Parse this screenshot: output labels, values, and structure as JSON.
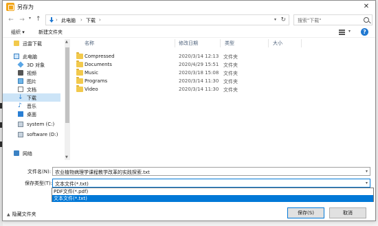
{
  "window": {
    "title": "另存为"
  },
  "address": {
    "crumbs": [
      "此电脑",
      "下载"
    ],
    "search_placeholder": "搜索\"下载\""
  },
  "toolbar": {
    "organize": "组织 ▾",
    "new_folder": "新建文件夹"
  },
  "sidebar": {
    "items": [
      {
        "label": "迅雷下载",
        "icon": "folder-icon"
      },
      {
        "label": "此电脑",
        "icon": "computer-icon"
      },
      {
        "label": "3D 对象",
        "icon": "cube-icon"
      },
      {
        "label": "视频",
        "icon": "video-icon"
      },
      {
        "label": "图片",
        "icon": "picture-icon"
      },
      {
        "label": "文档",
        "icon": "document-icon"
      },
      {
        "label": "下载",
        "icon": "download-icon"
      },
      {
        "label": "音乐",
        "icon": "music-icon"
      },
      {
        "label": "桌面",
        "icon": "desktop-icon"
      },
      {
        "label": "system (C:)",
        "icon": "drive-icon"
      },
      {
        "label": "software (D:)",
        "icon": "drive-icon"
      },
      {
        "label": "网络",
        "icon": "network-icon"
      }
    ]
  },
  "filelist": {
    "columns": [
      "名称",
      "修改日期",
      "类型",
      "大小"
    ],
    "rows": [
      {
        "name": "Compressed",
        "date": "2020/3/14 12:13",
        "type": "文件夹"
      },
      {
        "name": "Documents",
        "date": "2020/4/29 15:51",
        "type": "文件夹"
      },
      {
        "name": "Music",
        "date": "2020/3/18 15:08",
        "type": "文件夹"
      },
      {
        "name": "Programs",
        "date": "2020/3/14 11:30",
        "type": "文件夹"
      },
      {
        "name": "Video",
        "date": "2020/3/14 11:30",
        "type": "文件夹"
      }
    ]
  },
  "fields": {
    "filename_label": "文件名(N):",
    "filename_value": "农业植物病理学课程教学改革的实践探索.txt",
    "type_label": "保存类型(T):",
    "type_value": "文本文件(*.txt)",
    "type_options": [
      "PDF文件(*.pdf)",
      "文本文件(*.txt)"
    ]
  },
  "footer": {
    "hide_folders": "隐藏文件夹",
    "save": "保存(S)",
    "cancel": "取消"
  },
  "colors": {
    "accent": "#0078d7",
    "selection": "#cce4f7",
    "folder": "#f2c94c"
  }
}
